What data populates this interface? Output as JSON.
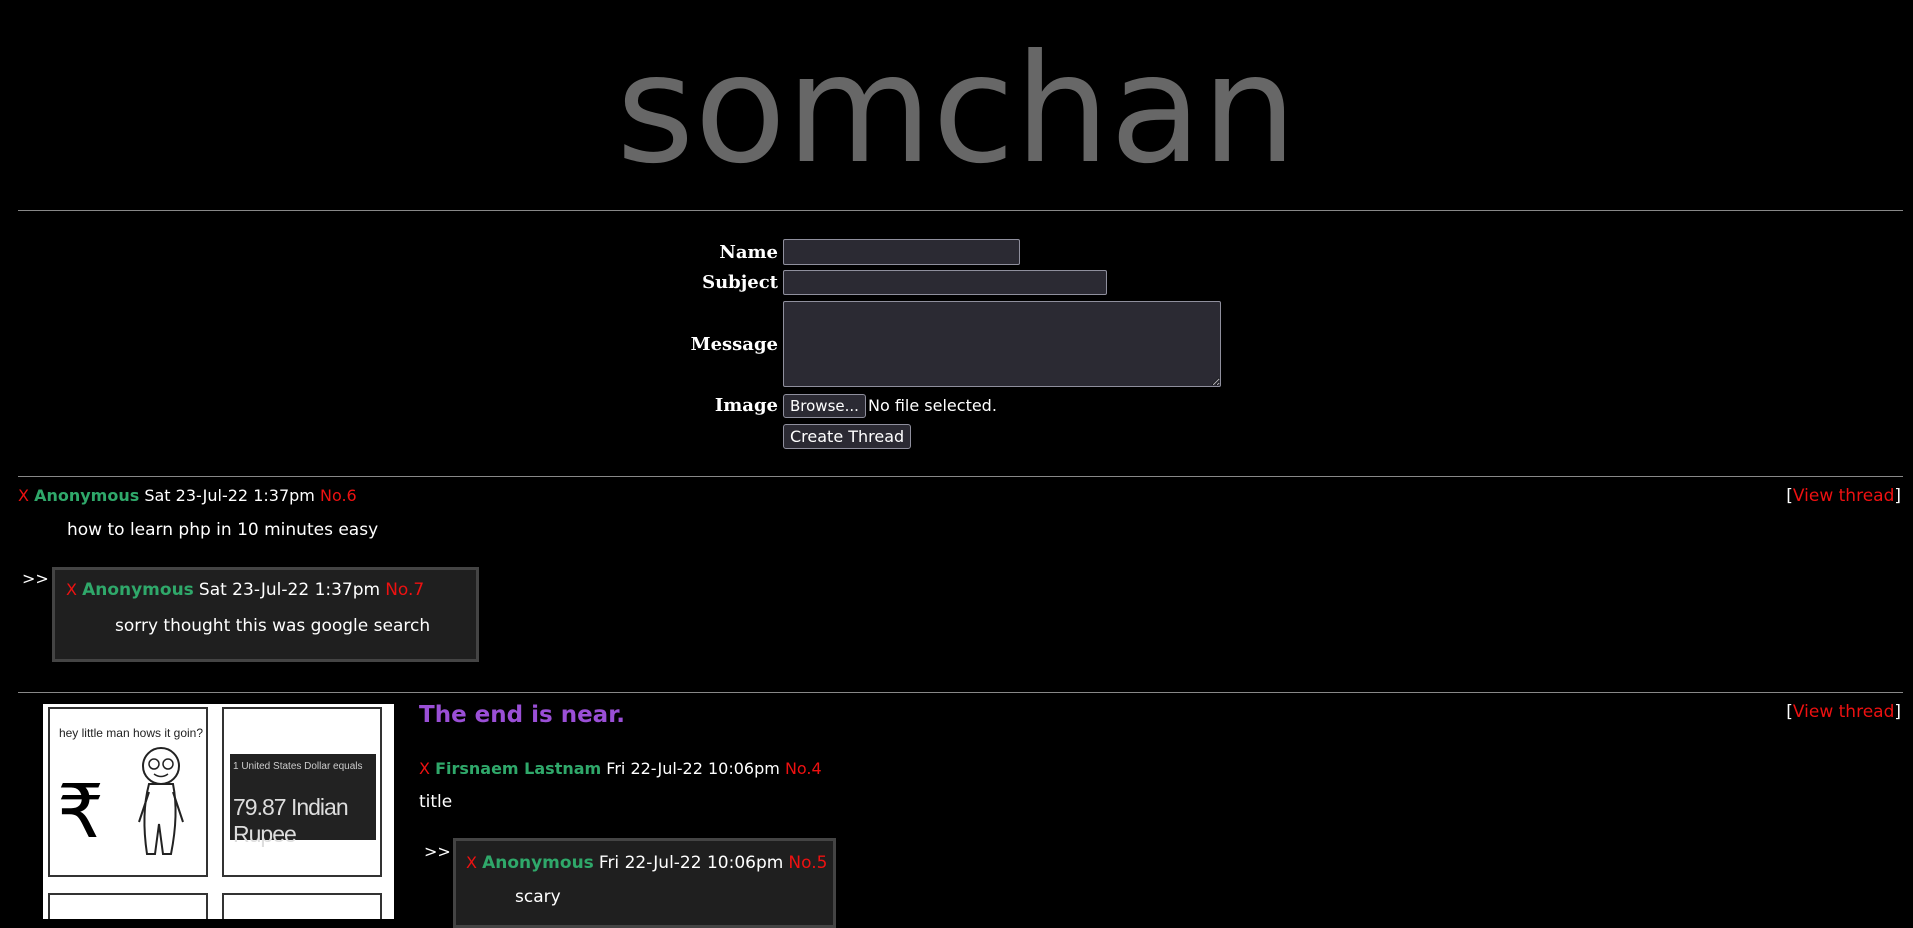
{
  "site": {
    "title": "somchan"
  },
  "form": {
    "name_label": "Name",
    "subject_label": "Subject",
    "message_label": "Message",
    "image_label": "Image",
    "name_value": "",
    "subject_value": "",
    "message_value": "",
    "browse_label": "Browse...",
    "file_status": "No file selected.",
    "submit_label": "Create Thread"
  },
  "threads": [
    {
      "subject": "",
      "op": {
        "delete": "X",
        "author": "Anonymous",
        "date": "Sat 23-Jul-22 1:37pm",
        "no": "No.6",
        "message": "how to learn php in 10 minutes easy"
      },
      "view": {
        "open": "[",
        "label": "View thread",
        "close": "]"
      },
      "replies": [
        {
          "arrows": ">>",
          "delete": "X",
          "author": "Anonymous",
          "date": "Sat 23-Jul-22 1:37pm",
          "no": "No.7",
          "message": "sorry thought this was google search"
        }
      ]
    },
    {
      "subject": "The end is near.",
      "op": {
        "delete": "X",
        "author": "Firsnaem Lastnam",
        "date": "Fri 22-Jul-22 10:06pm",
        "no": "No.4",
        "message": "title"
      },
      "image": {
        "panel1_text": "hey little man hows it goin?",
        "panel2_text1": "1 United States Dollar equals",
        "panel2_text2": "79.87 Indian Rupee",
        "symbol": "₹"
      },
      "view": {
        "open": "[",
        "label": "View thread",
        "close": "]"
      },
      "replies": [
        {
          "arrows": ">>",
          "delete": "X",
          "author": "Anonymous",
          "date": "Fri 22-Jul-22 10:06pm",
          "no": "No.5",
          "message": "scary"
        }
      ]
    }
  ]
}
